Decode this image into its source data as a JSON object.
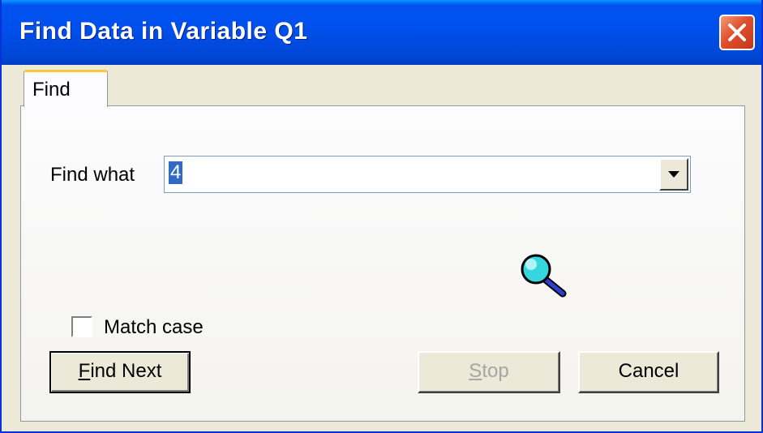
{
  "window": {
    "title": "Find Data in Variable Q1",
    "close_icon": "close-icon"
  },
  "tabs": [
    {
      "label": "Find",
      "selected": true
    }
  ],
  "find_what": {
    "label": "Find what",
    "value": "4",
    "selected": true
  },
  "icon": {
    "name": "magnifier-icon"
  },
  "match_case": {
    "label": "Match case",
    "checked": false
  },
  "buttons": {
    "find_next": {
      "label": "Find Next",
      "mnemonic": "F",
      "default": true
    },
    "stop": {
      "label": "Stop",
      "mnemonic": "S",
      "enabled": false
    },
    "cancel": {
      "label": "Cancel"
    }
  },
  "colors": {
    "titlebar": "#0050ee",
    "face": "#ece9d8",
    "selection": "#316ac5"
  }
}
